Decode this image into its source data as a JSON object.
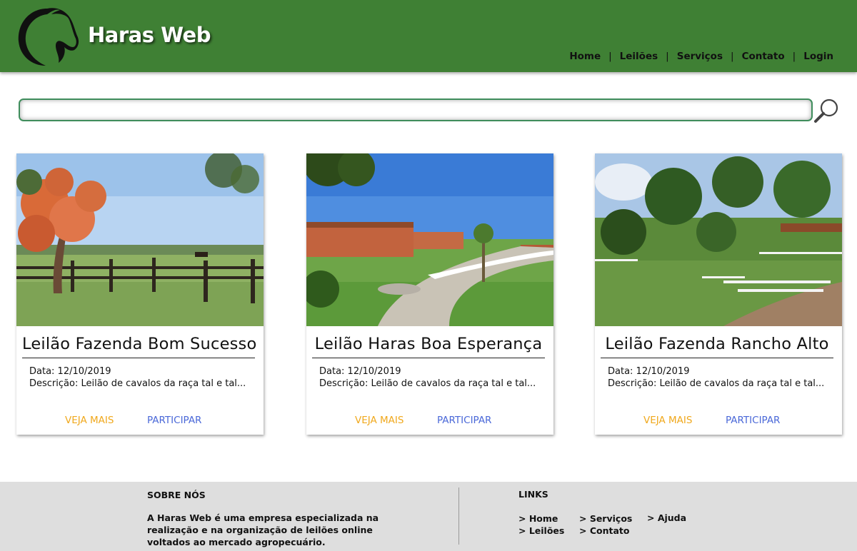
{
  "header": {
    "brand": "Haras Web",
    "nav": [
      "Home",
      "Leilões",
      "Serviços",
      "Contato",
      "Login"
    ],
    "separator": "|",
    "bg_color": "#3f8034"
  },
  "search": {
    "value": "",
    "placeholder": ""
  },
  "cards": [
    {
      "title": "Leilão Fazenda Bom Sucesso",
      "date": "Data: 12/10/2019",
      "description": "Descrição: Leilão de cavalos da raça tal e tal...",
      "more_label": "VEJA MAIS",
      "join_label": "PARTICIPAR"
    },
    {
      "title": "Leilão Haras Boa Esperança",
      "date": "Data: 12/10/2019",
      "description": "Descrição: Leilão de cavalos da raça tal e tal...",
      "more_label": "VEJA MAIS",
      "join_label": "PARTICIPAR"
    },
    {
      "title": "Leilão Fazenda Rancho Alto",
      "date": "Data: 12/10/2019",
      "description": "Descrição: Leilão de cavalos da raça tal e tal...",
      "more_label": "VEJA MAIS",
      "join_label": "PARTICIPAR"
    }
  ],
  "footer": {
    "about_heading": "SOBRE NÓS",
    "about_text": "A Haras Web é uma empresa especializada na realização e na organização de leilões online voltados ao mercado agropecuário.",
    "links_heading": "LINKS",
    "links": [
      "> Home",
      "> Leilões",
      "> Serviços",
      "> Contato",
      "> Ajuda"
    ]
  },
  "colors": {
    "accent_orange": "#f0a81c",
    "accent_blue": "#4a68d8",
    "footer_bg": "#dedede"
  }
}
